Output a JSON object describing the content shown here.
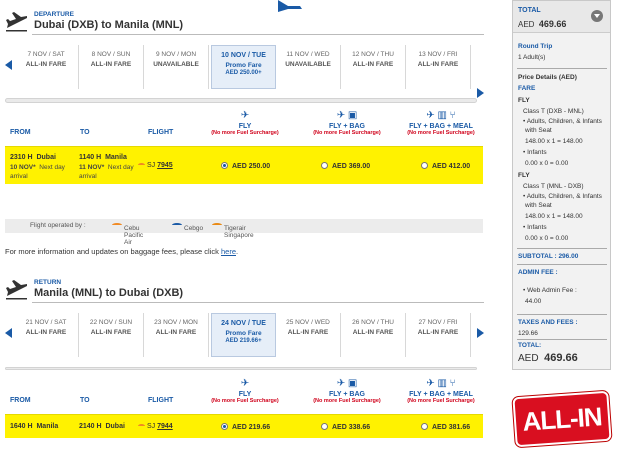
{
  "departure": {
    "kind": "DEPARTURE",
    "route": "Dubai (DXB) to Manila (MNL)",
    "dates": [
      {
        "date": "7 NOV / SAT",
        "fare": "ALL-IN FARE"
      },
      {
        "date": "8 NOV / SUN",
        "fare": "ALL-IN FARE"
      },
      {
        "date": "9 NOV / MON",
        "fare": "UNAVAILABLE"
      },
      {
        "date": "10 NOV / TUE",
        "fare": "Promo Fare",
        "price": "AED 250.00+"
      },
      {
        "date": "11 NOV / WED",
        "fare": "UNAVAILABLE"
      },
      {
        "date": "12 NOV / THU",
        "fare": "ALL-IN FARE"
      },
      {
        "date": "13 NOV / FRI",
        "fare": "ALL-IN FARE"
      }
    ],
    "headers": {
      "from": "FROM",
      "to": "TO",
      "flight": "FLIGHT"
    },
    "fare_types": [
      {
        "name": "FLY",
        "note": "(No more Fuel Surcharge)"
      },
      {
        "name": "FLY + BAG",
        "note": "(No more Fuel Surcharge)"
      },
      {
        "name": "FLY + BAG + MEAL",
        "note": "(No more Fuel Surcharge)"
      }
    ],
    "flight": {
      "dep_time": "2310 H",
      "dep_city": "Dubai",
      "dep_date": "10 NOV*",
      "dep_arr": "arrival",
      "next_day": "Next day",
      "arr_time": "1140 H",
      "arr_city": "Manila",
      "arr_date": "11 NOV*",
      "arr_arr": "arrival",
      "arr_next_day": "Next day",
      "carrier": "SJ",
      "number": "7945",
      "prices": [
        "AED 250.00",
        "AED 369.00",
        "AED 412.00"
      ],
      "selected_index": 0
    },
    "operated_by": {
      "label": "Flight operated by :",
      "carriers": [
        "Cebu Pacific Air",
        "Cebgo",
        "Tigerair Singapore"
      ]
    },
    "info_text": "For more information and updates on baggage fees, please click",
    "info_link": "here",
    "info_end": "."
  },
  "return": {
    "kind": "RETURN",
    "route": "Manila (MNL) to Dubai (DXB)",
    "dates": [
      {
        "date": "21 NOV / SAT",
        "fare": "ALL-IN FARE"
      },
      {
        "date": "22 NOV / SUN",
        "fare": "ALL-IN FARE"
      },
      {
        "date": "23 NOV / MON",
        "fare": "ALL-IN FARE"
      },
      {
        "date": "24 NOV / TUE",
        "fare": "Promo Fare",
        "price": "AED 219.66+"
      },
      {
        "date": "25 NOV / WED",
        "fare": "ALL-IN FARE"
      },
      {
        "date": "26 NOV / THU",
        "fare": "ALL-IN FARE"
      },
      {
        "date": "27 NOV / FRI",
        "fare": "ALL-IN FARE"
      }
    ],
    "headers": {
      "from": "FROM",
      "to": "TO",
      "flight": "FLIGHT"
    },
    "fare_types": [
      {
        "name": "FLY",
        "note": "(No more Fuel Surcharge)"
      },
      {
        "name": "FLY + BAG",
        "note": "(No more Fuel Surcharge)"
      },
      {
        "name": "FLY + BAG + MEAL",
        "note": "(No more Fuel Surcharge)"
      }
    ],
    "flight": {
      "dep_time": "1640 H",
      "dep_city": "Manila",
      "arr_time": "2140 H",
      "arr_city": "Dubai",
      "carrier": "SJ",
      "number": "7944",
      "prices": [
        "AED 219.66",
        "AED 338.66",
        "AED 381.66"
      ],
      "selected_index": 0
    }
  },
  "sidebar": {
    "total_label": "TOTAL",
    "total_currency": "AED",
    "total_value": "469.66",
    "trip_type": "Round Trip",
    "passengers": "1  Adult(s)",
    "price_details": "Price Details (AED)",
    "fare_label": "FARE",
    "legs": [
      {
        "code": "FLY",
        "class_line": "Class T (DXB - MNL)",
        "pax_lines": [
          "• Adults, Children, & Infants",
          "with Seat"
        ],
        "pax_calc": "148.00 x 1 = 148.00",
        "infant_label": "• Infants",
        "infant_calc": "0.00 x 0 = 0.00"
      },
      {
        "code": "FLY",
        "class_line": "Class T (MNL - DXB)",
        "pax_lines": [
          "• Adults, Children, & Infants",
          "with Seat"
        ],
        "pax_calc": "148.00 x 1 = 148.00",
        "infant_label": "• Infants",
        "infant_calc": "0.00 x 0 = 0.00"
      }
    ],
    "subtotal": "SUBTOTAL :  296.00",
    "admin_fee_label": "ADMIN FEE :",
    "web_admin_label": "• Web Admin Fee :",
    "web_admin_value": "44.00",
    "taxes_label": "TAXES AND FEES :",
    "taxes_value": "129.66",
    "total2_label": "TOTAL:",
    "grand_currency": "AED",
    "grand_value": "469.66"
  },
  "logo_text": "ALL-IN",
  "colors": {
    "accent_blue": "#1a5aa6",
    "highlight_yellow": "#fff200",
    "alert_red": "#d0021b",
    "logo_red": "#d90f20"
  }
}
